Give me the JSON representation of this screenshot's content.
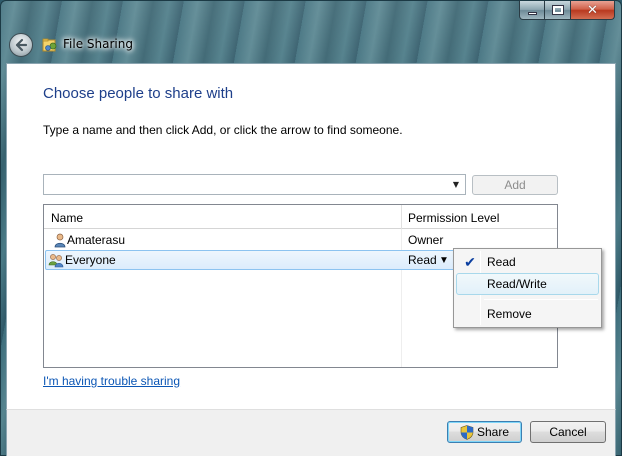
{
  "window": {
    "title": "File Sharing",
    "icons": {
      "back": "back-arrow-icon",
      "title": "file-sharing-icon",
      "minimize": "minimize-icon",
      "maximize": "maximize-icon",
      "close": "close-icon"
    }
  },
  "main": {
    "heading": "Choose people to share with",
    "instruction": "Type a name and then click Add, or click the arrow to find someone.",
    "name_input": {
      "value": "",
      "placeholder": ""
    },
    "add_label": "Add",
    "table": {
      "columns": [
        "Name",
        "Permission Level"
      ],
      "rows": [
        {
          "name": "Amaterasu",
          "permission": "Owner",
          "icon": "user-icon",
          "selected": false
        },
        {
          "name": "Everyone",
          "permission": "Read",
          "icon": "group-icon",
          "selected": true
        }
      ]
    },
    "trouble_link": "I'm having trouble sharing"
  },
  "permission_menu": {
    "items": [
      {
        "label": "Read",
        "checked": true
      },
      {
        "label": "Read/Write",
        "checked": false,
        "highlighted": true
      },
      {
        "label": "Remove",
        "checked": false
      }
    ]
  },
  "footer": {
    "share_label": "Share",
    "cancel_label": "Cancel"
  },
  "colors": {
    "heading": "#1e3f8a",
    "link": "#0b56b5",
    "selection": "#dcecfc"
  }
}
